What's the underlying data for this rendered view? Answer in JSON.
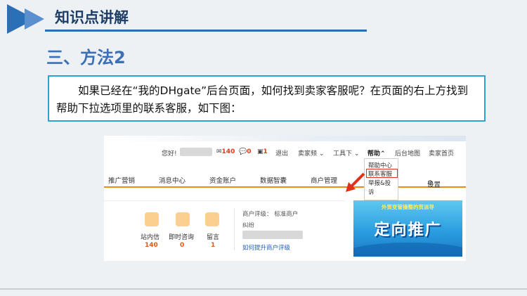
{
  "header": {
    "title": "知识点讲解"
  },
  "section": {
    "title": "三、方法2"
  },
  "question": {
    "text": "如果已经在“我的DHgate”后台页面，如何找到卖家客服呢？在页面的右上方找到帮助下拉选项里的联系客服，如下图："
  },
  "screenshot": {
    "topbar": {
      "greeting": "您好!",
      "msg_count": "140",
      "chat_count": "0",
      "notice_count": "1",
      "logout": "退出",
      "seller_menu": "卖家频 ⌄",
      "tools_menu": "工具下 ⌄",
      "help_menu": "帮助⌃",
      "sitemap": "后台地图",
      "seller_home": "卖家首页"
    },
    "help_dropdown": {
      "items": [
        "帮助中心",
        "联系客服",
        "举报&投",
        "诉"
      ]
    },
    "nav": {
      "items": [
        "推广营销",
        "消息中心",
        "资金账户",
        "数据智囊",
        "商户管理",
        "设置"
      ]
    },
    "panel": {
      "inbox_label": "站内信",
      "inbox_count": "140",
      "chat_label": "即时咨询",
      "chat_count": "0",
      "note_label": "留言",
      "note_count": "1",
      "rating_label": "商户评级： 标准商户",
      "rating_sub": "纠纷",
      "rating_link": "如何提升商户评级"
    },
    "banner": {
      "top_text": "外贸变管操整的贸派导",
      "main_text": "定向推广"
    }
  },
  "colors": {
    "accent": "#2b6fb6",
    "box_border": "#29a3d6",
    "nav_underline": "#f08a14",
    "highlight": "#e0321a"
  }
}
